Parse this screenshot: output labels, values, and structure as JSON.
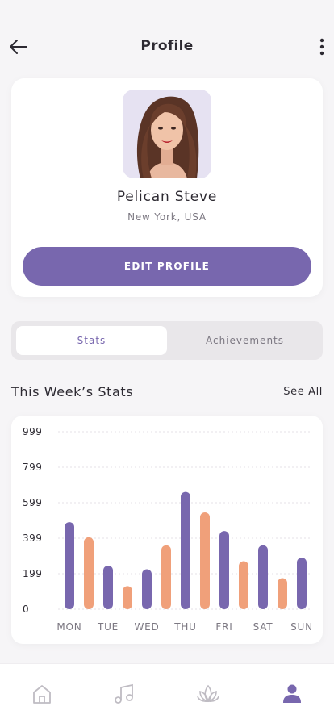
{
  "header": {
    "title": "Profile"
  },
  "profile": {
    "name": "Pelican Steve",
    "location": "New York, USA",
    "edit_label": "EDIT PROFILE"
  },
  "tabs": [
    {
      "label": "Stats",
      "active": true
    },
    {
      "label": "Achievements",
      "active": false
    }
  ],
  "section": {
    "title": "This Week’s Stats",
    "see_all": "See All"
  },
  "chart_data": {
    "type": "bar",
    "categories": [
      "MON",
      "TUE",
      "WED",
      "THU",
      "FRI",
      "SAT",
      "SUN"
    ],
    "yticks": [
      "999",
      "799",
      "599",
      "399",
      "199",
      "0"
    ],
    "ylim": [
      0,
      999
    ],
    "series": [
      {
        "color": "#7867ae",
        "values": [
          490,
          245,
          225,
          660,
          440,
          360,
          290
        ]
      },
      {
        "color": "#f0a07a",
        "values": [
          405,
          130,
          360,
          545,
          270,
          175
        ]
      }
    ],
    "grid": "dotted"
  },
  "colors": {
    "accent": "#7867ae",
    "secondary": "#f0a07a"
  },
  "bottom_nav": [
    {
      "icon": "home-icon",
      "active": false
    },
    {
      "icon": "music-icon",
      "active": false
    },
    {
      "icon": "lotus-icon",
      "active": false
    },
    {
      "icon": "user-icon",
      "active": true
    }
  ]
}
